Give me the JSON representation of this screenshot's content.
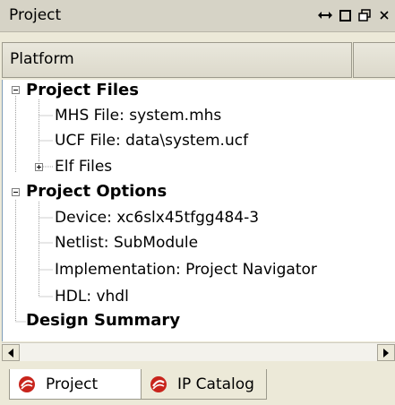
{
  "window": {
    "title": "Project",
    "buttons": [
      "move",
      "maximize",
      "restore",
      "close"
    ]
  },
  "toolbar": {
    "platform_label": "Platform"
  },
  "tree": {
    "project_files": {
      "label": "Project Files",
      "children": {
        "mhs": "MHS File: system.mhs",
        "ucf": "UCF File: data\\system.ucf",
        "elf": "Elf Files"
      }
    },
    "project_options": {
      "label": "Project Options",
      "children": {
        "device": "Device: xc6slx45tfgg484-3",
        "netlist": "Netlist: SubModule",
        "implementation": "Implementation: Project Navigator",
        "hdl": "HDL: vhdl"
      }
    },
    "design_summary": {
      "label": "Design Summary"
    }
  },
  "tabs": [
    {
      "label": "Project",
      "icon": "project-icon",
      "active": true
    },
    {
      "label": "IP Catalog",
      "icon": "ip-catalog-icon",
      "active": false
    }
  ],
  "colors": {
    "tree_background": "#ffffff",
    "chrome": "#ece9d8",
    "tree_line": "#a0a0a0",
    "icon_red": "#c8241c"
  }
}
